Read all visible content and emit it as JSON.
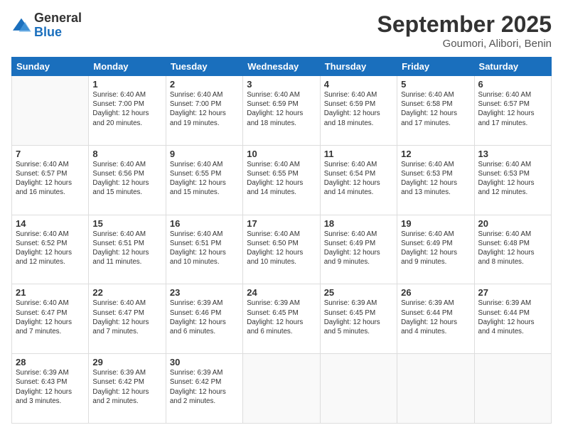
{
  "header": {
    "logo_general": "General",
    "logo_blue": "Blue",
    "month": "September 2025",
    "location": "Goumori, Alibori, Benin"
  },
  "weekdays": [
    "Sunday",
    "Monday",
    "Tuesday",
    "Wednesday",
    "Thursday",
    "Friday",
    "Saturday"
  ],
  "weeks": [
    [
      {
        "day": "",
        "info": ""
      },
      {
        "day": "1",
        "info": "Sunrise: 6:40 AM\nSunset: 7:00 PM\nDaylight: 12 hours\nand 20 minutes."
      },
      {
        "day": "2",
        "info": "Sunrise: 6:40 AM\nSunset: 7:00 PM\nDaylight: 12 hours\nand 19 minutes."
      },
      {
        "day": "3",
        "info": "Sunrise: 6:40 AM\nSunset: 6:59 PM\nDaylight: 12 hours\nand 18 minutes."
      },
      {
        "day": "4",
        "info": "Sunrise: 6:40 AM\nSunset: 6:59 PM\nDaylight: 12 hours\nand 18 minutes."
      },
      {
        "day": "5",
        "info": "Sunrise: 6:40 AM\nSunset: 6:58 PM\nDaylight: 12 hours\nand 17 minutes."
      },
      {
        "day": "6",
        "info": "Sunrise: 6:40 AM\nSunset: 6:57 PM\nDaylight: 12 hours\nand 17 minutes."
      }
    ],
    [
      {
        "day": "7",
        "info": "Sunrise: 6:40 AM\nSunset: 6:57 PM\nDaylight: 12 hours\nand 16 minutes."
      },
      {
        "day": "8",
        "info": "Sunrise: 6:40 AM\nSunset: 6:56 PM\nDaylight: 12 hours\nand 15 minutes."
      },
      {
        "day": "9",
        "info": "Sunrise: 6:40 AM\nSunset: 6:55 PM\nDaylight: 12 hours\nand 15 minutes."
      },
      {
        "day": "10",
        "info": "Sunrise: 6:40 AM\nSunset: 6:55 PM\nDaylight: 12 hours\nand 14 minutes."
      },
      {
        "day": "11",
        "info": "Sunrise: 6:40 AM\nSunset: 6:54 PM\nDaylight: 12 hours\nand 14 minutes."
      },
      {
        "day": "12",
        "info": "Sunrise: 6:40 AM\nSunset: 6:53 PM\nDaylight: 12 hours\nand 13 minutes."
      },
      {
        "day": "13",
        "info": "Sunrise: 6:40 AM\nSunset: 6:53 PM\nDaylight: 12 hours\nand 12 minutes."
      }
    ],
    [
      {
        "day": "14",
        "info": "Sunrise: 6:40 AM\nSunset: 6:52 PM\nDaylight: 12 hours\nand 12 minutes."
      },
      {
        "day": "15",
        "info": "Sunrise: 6:40 AM\nSunset: 6:51 PM\nDaylight: 12 hours\nand 11 minutes."
      },
      {
        "day": "16",
        "info": "Sunrise: 6:40 AM\nSunset: 6:51 PM\nDaylight: 12 hours\nand 10 minutes."
      },
      {
        "day": "17",
        "info": "Sunrise: 6:40 AM\nSunset: 6:50 PM\nDaylight: 12 hours\nand 10 minutes."
      },
      {
        "day": "18",
        "info": "Sunrise: 6:40 AM\nSunset: 6:49 PM\nDaylight: 12 hours\nand 9 minutes."
      },
      {
        "day": "19",
        "info": "Sunrise: 6:40 AM\nSunset: 6:49 PM\nDaylight: 12 hours\nand 9 minutes."
      },
      {
        "day": "20",
        "info": "Sunrise: 6:40 AM\nSunset: 6:48 PM\nDaylight: 12 hours\nand 8 minutes."
      }
    ],
    [
      {
        "day": "21",
        "info": "Sunrise: 6:40 AM\nSunset: 6:47 PM\nDaylight: 12 hours\nand 7 minutes."
      },
      {
        "day": "22",
        "info": "Sunrise: 6:40 AM\nSunset: 6:47 PM\nDaylight: 12 hours\nand 7 minutes."
      },
      {
        "day": "23",
        "info": "Sunrise: 6:39 AM\nSunset: 6:46 PM\nDaylight: 12 hours\nand 6 minutes."
      },
      {
        "day": "24",
        "info": "Sunrise: 6:39 AM\nSunset: 6:45 PM\nDaylight: 12 hours\nand 6 minutes."
      },
      {
        "day": "25",
        "info": "Sunrise: 6:39 AM\nSunset: 6:45 PM\nDaylight: 12 hours\nand 5 minutes."
      },
      {
        "day": "26",
        "info": "Sunrise: 6:39 AM\nSunset: 6:44 PM\nDaylight: 12 hours\nand 4 minutes."
      },
      {
        "day": "27",
        "info": "Sunrise: 6:39 AM\nSunset: 6:44 PM\nDaylight: 12 hours\nand 4 minutes."
      }
    ],
    [
      {
        "day": "28",
        "info": "Sunrise: 6:39 AM\nSunset: 6:43 PM\nDaylight: 12 hours\nand 3 minutes."
      },
      {
        "day": "29",
        "info": "Sunrise: 6:39 AM\nSunset: 6:42 PM\nDaylight: 12 hours\nand 2 minutes."
      },
      {
        "day": "30",
        "info": "Sunrise: 6:39 AM\nSunset: 6:42 PM\nDaylight: 12 hours\nand 2 minutes."
      },
      {
        "day": "",
        "info": ""
      },
      {
        "day": "",
        "info": ""
      },
      {
        "day": "",
        "info": ""
      },
      {
        "day": "",
        "info": ""
      }
    ]
  ]
}
